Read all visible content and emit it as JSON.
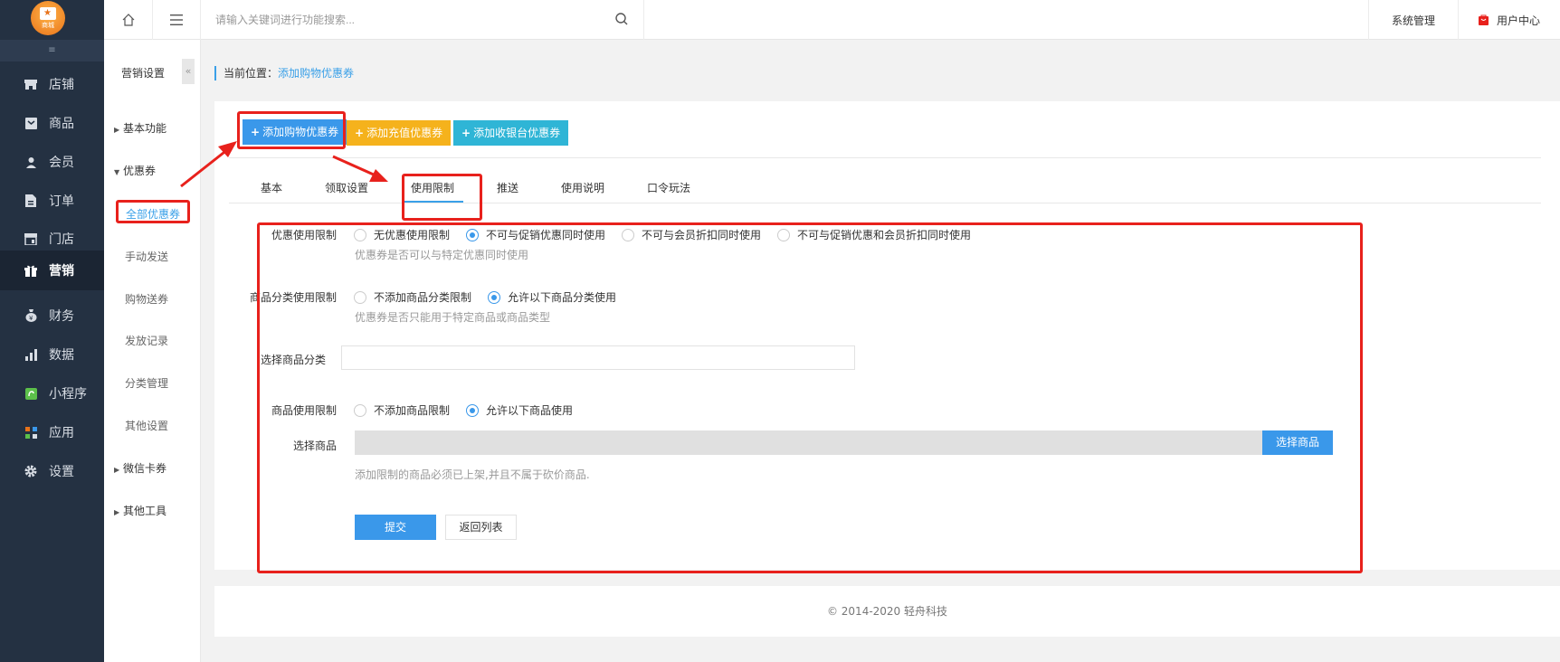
{
  "brand": {
    "logo_text": "商城"
  },
  "sidebar": {
    "collapse_glyph": "≡",
    "items": [
      {
        "label": "店铺",
        "icon": "store-icon"
      },
      {
        "label": "商品",
        "icon": "goods-icon"
      },
      {
        "label": "会员",
        "icon": "member-icon"
      },
      {
        "label": "订单",
        "icon": "order-icon"
      },
      {
        "label": "门店",
        "icon": "shop-icon"
      },
      {
        "label": "营销",
        "icon": "gift-icon",
        "active": true
      },
      {
        "label": "财务",
        "icon": "money-bag-icon"
      },
      {
        "label": "数据",
        "icon": "chart-icon"
      },
      {
        "label": "小程序",
        "icon": "miniprogram-icon"
      },
      {
        "label": "应用",
        "icon": "apps-icon"
      },
      {
        "label": "设置",
        "icon": "gear-icon"
      }
    ]
  },
  "subnav": {
    "title": "营销设置",
    "toggle_glyph": "«",
    "basic": "基本功能",
    "coupons": "优惠券",
    "all_coupons": "全部优惠券",
    "manual_send": "手动发送",
    "shopping_gift": "购物送券",
    "send_records": "发放记录",
    "category_manage": "分类管理",
    "other_settings": "其他设置",
    "wechat_card": "微信卡券",
    "other_tools": "其他工具"
  },
  "topbar": {
    "search_placeholder": "请输入关键词进行功能搜索...",
    "system_manage": "系统管理",
    "user_center": "用户中心"
  },
  "breadcrumb": {
    "prefix": "当前位置：",
    "current": "添加购物优惠券"
  },
  "actions": {
    "add_shopping": "添加购物优惠券",
    "add_recharge": "添加充值优惠券",
    "add_cashier": "添加收银台优惠券"
  },
  "tabs": [
    "基本",
    "领取设置",
    "使用限制",
    "推送",
    "使用说明",
    "口令玩法"
  ],
  "form": {
    "discount_limit_label": "优惠使用限制",
    "discount_options": [
      "无优惠使用限制",
      "不可与促销优惠同时使用",
      "不可与会员折扣同时使用",
      "不可与促销优惠和会员折扣同时使用"
    ],
    "discount_hint": "优惠券是否可以与特定优惠同时使用",
    "category_limit_label": "商品分类使用限制",
    "category_options": [
      "不添加商品分类限制",
      "允许以下商品分类使用"
    ],
    "category_hint": "优惠券是否只能用于特定商品或商品类型",
    "select_category_label": "选择商品分类",
    "goods_limit_label": "商品使用限制",
    "goods_options": [
      "不添加商品限制",
      "允许以下商品使用"
    ],
    "select_goods_label": "选择商品",
    "select_goods_button": "选择商品",
    "goods_hint": "添加限制的商品必须已上架,并且不属于砍价商品.",
    "submit": "提交",
    "back": "返回列表"
  },
  "footer": {
    "copyright": "© 2014-2020 轻舟科技"
  },
  "colors": {
    "accent": "#3a98ea",
    "highlight": "#e8211c",
    "sidebar": "#243142"
  }
}
